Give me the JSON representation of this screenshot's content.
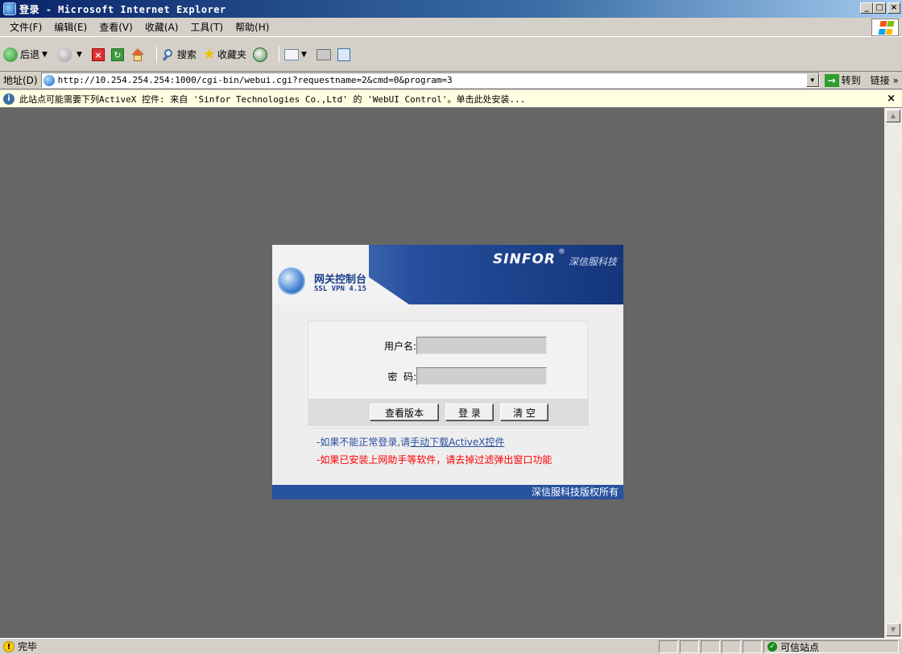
{
  "window": {
    "title": "登录 - Microsoft Internet Explorer",
    "min": "_",
    "max": "□",
    "close": "×"
  },
  "menu": {
    "items": [
      {
        "label": "文件(F)"
      },
      {
        "label": "编辑(E)"
      },
      {
        "label": "查看(V)"
      },
      {
        "label": "收藏(A)"
      },
      {
        "label": "工具(T)"
      },
      {
        "label": "帮助(H)"
      }
    ]
  },
  "toolbar": {
    "back": "后退",
    "search": "搜索",
    "favorites": "收藏夹"
  },
  "address": {
    "label": "地址(D)",
    "url": "http://10.254.254.254:1000/cgi-bin/webui.cgi?requestname=2&cmd=0&program=3",
    "go": "转到",
    "links": "链接 »"
  },
  "infobar": {
    "text": "此站点可能需要下列ActiveX 控件: 来自 'Sinfor Technologies Co.,Ltd' 的 'WebUI Control'。单击此处安装..."
  },
  "login": {
    "product_title": "网关控制台",
    "product_version": "SSL VPN 4.15",
    "brand": "SINFOR",
    "brand_reg": "®",
    "brand_cn": "深信服科技",
    "username_label": "用户名:",
    "password_label": "密  码:",
    "username_value": "",
    "password_value": "",
    "btn_version": "查看版本",
    "btn_login": "登 录",
    "btn_clear": "清 空",
    "notice_blue_prefix": "-如果不能正常登录,请",
    "notice_blue_link": "手动下载ActiveX控件",
    "notice_red": "-如果已安装上网助手等软件，请去掉过滤弹出窗口功能",
    "footer": "深信服科技版权所有"
  },
  "status": {
    "text": "完毕",
    "zone": "可信站点"
  },
  "colors": {
    "content_bg": "#666666",
    "header_blue": "#27539f",
    "notice_red": "#ff0000",
    "notice_blue": "#2a4ea0"
  }
}
